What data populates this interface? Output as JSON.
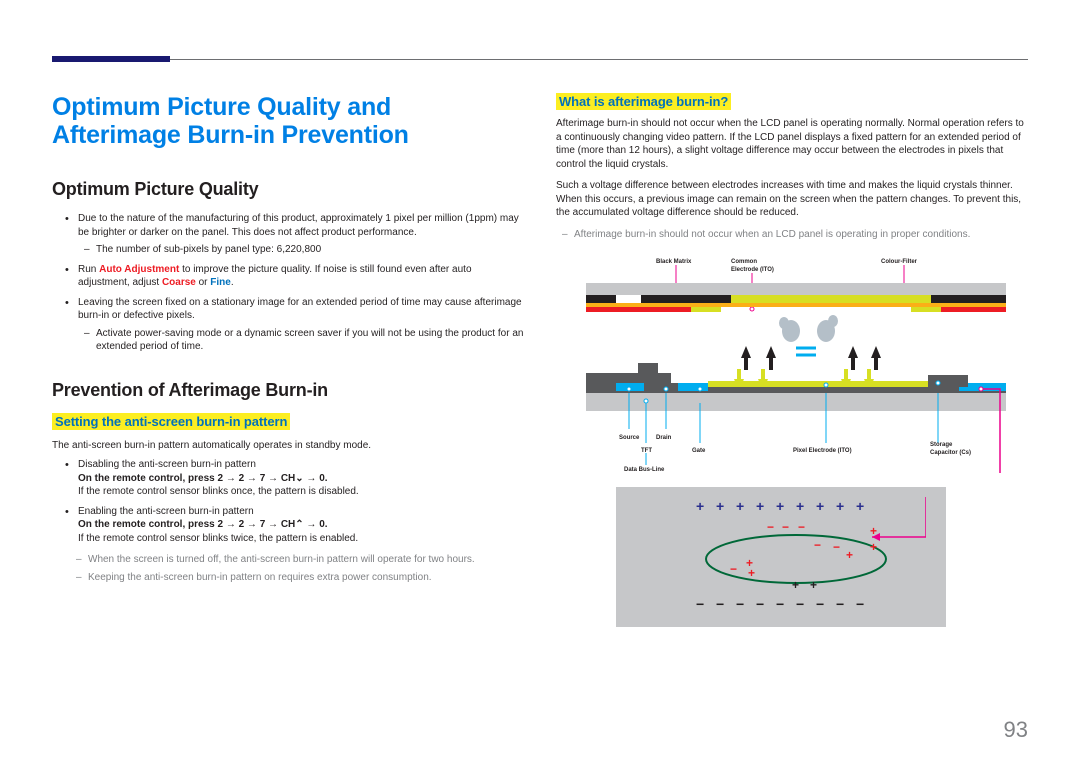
{
  "page_number": "93",
  "title": "Optimum Picture Quality and Afterimage Burn-in Prevention",
  "left": {
    "h2a": "Optimum Picture Quality",
    "b1": "Due to the nature of the manufacturing of this product, approximately 1 pixel per million (1ppm) may be brighter or darker on the panel. This does not affect product performance.",
    "b1d1": "The number of sub-pixels by panel type: 6,220,800",
    "b2_pre": "Run ",
    "b2_autoadj": "Auto Adjustment",
    "b2_mid": " to improve the picture quality. If noise is still found even after auto adjustment, adjust ",
    "b2_coarse": "Coarse",
    "b2_or": " or ",
    "b2_fine": "Fine",
    "b2_end": ".",
    "b3": "Leaving the screen fixed on a stationary image for an extended period of time may cause afterimage burn-in or defective pixels.",
    "b3d1": "Activate power-saving mode or a dynamic screen saver if you will not be using the product for an extended period of time.",
    "h2b": "Prevention of Afterimage Burn-in",
    "h3a": "Setting the anti-screen burn-in pattern",
    "intro": "The anti-screen burn-in pattern automatically operates in standby mode.",
    "p1": "Disabling the anti-screen burn-in pattern",
    "p1bold": "On the remote control, press 2 → 2 → 7 → CH⌄ → 0.",
    "p1text": "If the remote control sensor blinks once, the pattern is disabled.",
    "p2": "Enabling the anti-screen burn-in pattern",
    "p2bold": "On the remote control, press 2 → 2 → 7 → CH⌃ → 0.",
    "p2text": "If the remote control sensor blinks twice, the pattern is enabled.",
    "n1": "When the screen is turned off, the anti-screen burn-in pattern will operate for two hours.",
    "n2": "Keeping the anti-screen burn-in pattern on requires extra power consumption."
  },
  "right": {
    "h3a": "What is afterimage burn-in?",
    "p1": "Afterimage burn-in should not occur when the LCD panel is operating normally. Normal operation refers to a continuously changing video pattern. If the LCD panel displays a fixed pattern for an extended period of time (more than 12 hours), a slight voltage difference may occur between the electrodes in pixels that control the liquid crystals.",
    "p2": "Such a voltage difference between electrodes increases with time and makes the liquid crystals thinner. When this occurs, a previous image can remain on the screen when the pattern changes. To prevent this, the accumulated voltage difference should be reduced.",
    "n1": "Afterimage burn-in should not occur when an LCD panel is operating in proper conditions.",
    "labels": {
      "black_matrix": "Black Matrix",
      "common_electrode": "Common Electrode (ITO)",
      "colour_filter": "Colour-Filter",
      "source": "Source",
      "drain": "Drain",
      "tft": "TFT",
      "gate": "Gate",
      "pixel_electrode": "Pixel Electrode (ITO)",
      "storage_capacitor": "Storage Capacitor (Cs)",
      "data_busline": "Data Bus-Line"
    }
  }
}
